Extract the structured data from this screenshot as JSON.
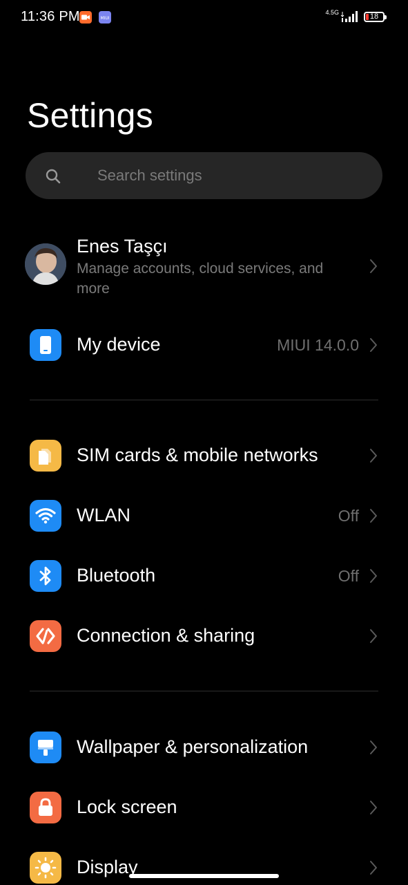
{
  "status_bar": {
    "time": "11:36 PM",
    "network": "4.5G",
    "battery_level": "18",
    "notification_icons": [
      "video-camera-icon",
      "miui-icon"
    ]
  },
  "page_title": "Settings",
  "search": {
    "placeholder": "Search settings"
  },
  "account": {
    "name": "Enes Taşçı",
    "subtitle": "Manage accounts, cloud services, and more"
  },
  "items": [
    {
      "label": "My device",
      "value": "MIUI 14.0.0",
      "icon": "phone-icon",
      "color": "#1e8bf5"
    },
    {
      "label": "SIM cards & mobile networks",
      "value": "",
      "icon": "sim-card-icon",
      "color": "#f5b946"
    },
    {
      "label": "WLAN",
      "value": "Off",
      "icon": "wifi-icon",
      "color": "#1e8bf5"
    },
    {
      "label": "Bluetooth",
      "value": "Off",
      "icon": "bluetooth-icon",
      "color": "#1e8bf5"
    },
    {
      "label": "Connection & sharing",
      "value": "",
      "icon": "connection-sharing-icon",
      "color": "#f36b43"
    },
    {
      "label": "Wallpaper & personalization",
      "value": "",
      "icon": "wallpaper-icon",
      "color": "#1e8bf5"
    },
    {
      "label": "Lock screen",
      "value": "",
      "icon": "lock-icon",
      "color": "#f36b43"
    },
    {
      "label": "Display",
      "value": "",
      "icon": "brightness-icon",
      "color": "#f5b946"
    }
  ],
  "colors": {
    "background": "#000000",
    "search_background": "#262626",
    "secondary_text": "#7a7a7a",
    "divider": "#2e2e2e"
  }
}
